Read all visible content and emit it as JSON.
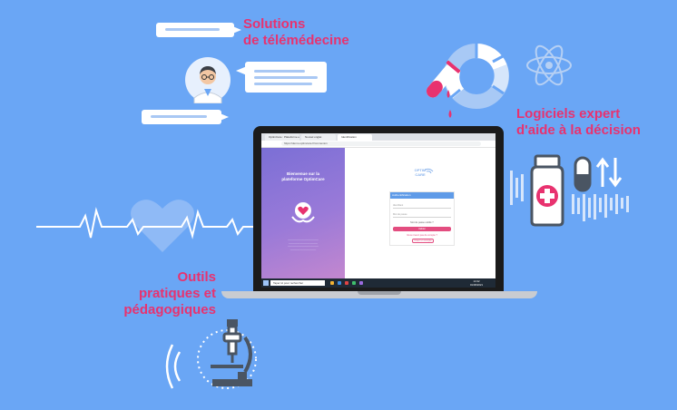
{
  "labels": {
    "telemedicine_line1": "Solutions",
    "telemedicine_line2": "de télémédecine",
    "decision_line1": "Logiciels expert",
    "decision_line2": "d'aide à la décision",
    "tools_line1": "Outils",
    "tools_line2": "pratiques et",
    "tools_line3": "pédagogiques"
  },
  "browser": {
    "tabs": [
      "OptimCare : Plateforme e-santé",
      "Nouvel onglet",
      "Identification"
    ],
    "address": "https://demo.optimcare.fr/connexion"
  },
  "welcome": {
    "line1": "Bienvenue sur la",
    "line2": "plateforme OptimCare"
  },
  "logo": {
    "line1": "OPTIM",
    "line2": "CARE"
  },
  "login": {
    "header": "Authentification",
    "field1": "Identifiant",
    "field2": "Mot de passe",
    "forgot": "Mot de passe oublié ?",
    "button": "Valider",
    "create": "Vous n'avez pas de compte ?",
    "create_link": "Créer un compte"
  },
  "taskbar": {
    "search": "Taper ici pour rechercher",
    "time": "14:32",
    "date": "01/06/2021"
  },
  "colors": {
    "background": "#6aa6f5",
    "accent_pink": "#e8326f",
    "icon_gray": "#4a5563"
  },
  "icons": [
    "doctor-avatar-icon",
    "test-tube-icon",
    "pie-chart-icon",
    "atom-icon",
    "medicine-bottle-icon",
    "pill-icon",
    "sort-arrows-icon",
    "heart-icon",
    "microscope-icon",
    "sound-waves-icon"
  ]
}
